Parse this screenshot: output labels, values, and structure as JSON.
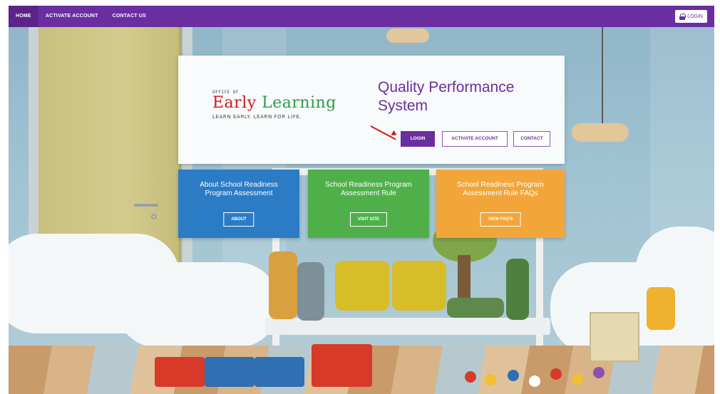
{
  "nav": {
    "items": [
      {
        "label": "HOME",
        "active": true
      },
      {
        "label": "ACTIVATE ACCOUNT",
        "active": false
      },
      {
        "label": "CONTACT US",
        "active": false
      }
    ],
    "login_label": "LOGIN",
    "login_icon": "lock-icon"
  },
  "hero": {
    "logo_top": "OFFICE OF",
    "logo_word1": "Early",
    "logo_word2": "Learning",
    "logo_tagline": "LEARN EARLY. LEARN FOR LIFE.",
    "title_line1": "Quality Performance",
    "title_line2": "System",
    "buttons": {
      "login": "LOGIN",
      "activate": "ACTIVATE ACCOUNT",
      "contact": "CONTACT"
    }
  },
  "cards": [
    {
      "title": "About School Readiness Program Assessment",
      "button": "ABOUT",
      "color": "#2b7cc4"
    },
    {
      "title": "School Readiness Program Assessment Rule",
      "button": "VISIT SITE",
      "color": "#4fb04a"
    },
    {
      "title": "School Readiness Program Assessment Rule FAQs",
      "button": "VIEW FAQ'S",
      "color": "#f2a63a"
    }
  ],
  "colors": {
    "brand_purple": "#6a2ea0",
    "annotation_arrow": "#d2161b"
  }
}
